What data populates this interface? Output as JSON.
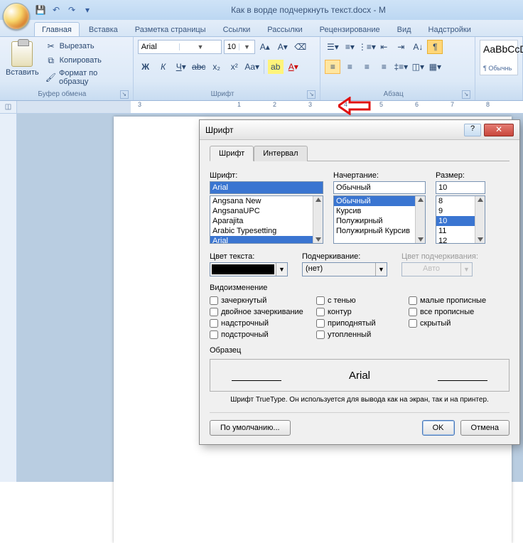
{
  "title": "Как в ворде подчеркнуть текст.docx - M",
  "tabs": [
    "Главная",
    "Вставка",
    "Разметка страницы",
    "Ссылки",
    "Рассылки",
    "Рецензирование",
    "Вид",
    "Надстройки"
  ],
  "clipboard": {
    "paste": "Вставить",
    "cut": "Вырезать",
    "copy": "Копировать",
    "format": "Формат по образцу",
    "group": "Буфер обмена"
  },
  "font": {
    "name": "Arial",
    "size": "10",
    "group": "Шрифт"
  },
  "para": {
    "group": "Абзац"
  },
  "styles": {
    "sample": "AaBbCcD",
    "name": "¶ Обычнь"
  },
  "dialog": {
    "title": "Шрифт",
    "tab_font": "Шрифт",
    "tab_spacing": "Интервал",
    "font_label": "Шрифт:",
    "font_value": "Arial",
    "font_list": [
      "Angsana New",
      "AngsanaUPC",
      "Aparajita",
      "Arabic Typesetting",
      "Arial"
    ],
    "style_label": "Начертание:",
    "style_value": "Обычный",
    "style_list": [
      "Обычный",
      "Курсив",
      "Полужирный",
      "Полужирный Курсив"
    ],
    "size_label": "Размер:",
    "size_value": "10",
    "size_list": [
      "8",
      "9",
      "10",
      "11",
      "12"
    ],
    "color_label": "Цвет текста:",
    "underline_label": "Подчеркивание:",
    "underline_value": "(нет)",
    "undercolor_label": "Цвет подчеркивания:",
    "undercolor_value": "Авто",
    "effects_label": "Видоизменение",
    "effects": {
      "strike": "зачеркнутый",
      "dstrike": "двойное зачеркивание",
      "super": "надстрочный",
      "sub": "подстрочный",
      "shadow": "с тенью",
      "outline": "контур",
      "emboss": "приподнятый",
      "engrave": "утопленный",
      "smallcaps": "малые прописные",
      "allcaps": "все прописные",
      "hidden": "скрытый"
    },
    "sample_label": "Образец",
    "sample_text": "Arial",
    "note": "Шрифт TrueType. Он используется для вывода как на экран, так и на принтер.",
    "default_btn": "По умолчанию...",
    "ok": "OK",
    "cancel": "Отмена"
  }
}
